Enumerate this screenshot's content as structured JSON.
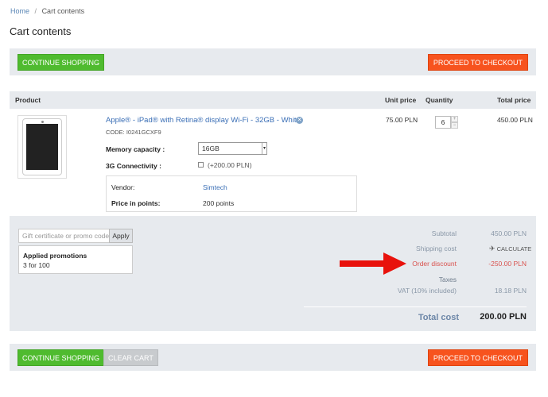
{
  "breadcrumb": {
    "home": "Home",
    "separator": "/",
    "current": "Cart contents"
  },
  "page_title": "Cart contents",
  "buttons": {
    "continue_shopping": "CONTINUE SHOPPING",
    "proceed_to_checkout": "PROCEED TO CHECKOUT",
    "clear_cart": "CLEAR CART",
    "apply": "Apply",
    "calculate": "CALCULATE"
  },
  "table_headers": {
    "product": "Product",
    "unit_price": "Unit price",
    "quantity": "Quantity",
    "total_price": "Total price"
  },
  "item": {
    "name": "Apple® - iPad® with Retina® display Wi-Fi - 32GB - White",
    "code": "CODE: I0241GCXF9",
    "options": {
      "memory_label": "Memory capacity :",
      "memory_value": "16GB",
      "connectivity_label": "3G Connectivity :",
      "connectivity_price": "(+200.00 PLN)"
    },
    "vendor_label": "Vendor:",
    "vendor_value": "Simtech",
    "points_label": "Price in points:",
    "points_value": "200 points",
    "unit_price": "75.00 PLN",
    "quantity": "6",
    "total_price": "450.00 PLN"
  },
  "promo": {
    "placeholder": "Gift certificate or promo code",
    "applied_title": "Applied promotions",
    "applied_value": "3 for 100"
  },
  "summary": {
    "subtotal_label": "Subtotal",
    "subtotal_value": "450.00 PLN",
    "shipping_label": "Shipping cost",
    "discount_label": "Order discount",
    "discount_value": "-250.00 PLN",
    "taxes_label": "Taxes",
    "vat_label": "VAT (10% included)",
    "vat_value": "18.18 PLN",
    "total_label": "Total cost",
    "total_value": "200.00 PLN"
  },
  "colors": {
    "green_button": "#4fbb2f",
    "orange_button": "#f7531e",
    "panel_bg": "#e7eaee",
    "link": "#3b6fb6",
    "discount_red": "#d9534f",
    "annotation_arrow": "#e8120c"
  }
}
